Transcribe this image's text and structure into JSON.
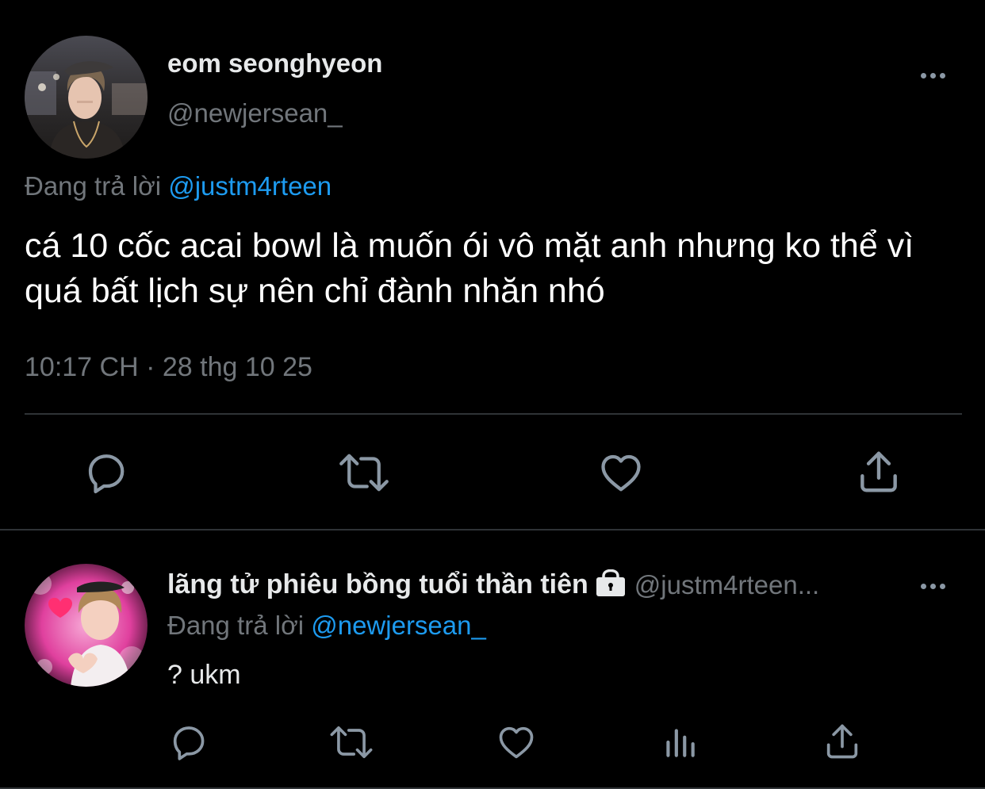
{
  "main_tweet": {
    "display_name": "eom seonghyeon",
    "handle": "@newjersean_",
    "reply_prefix": "Đang trả lời",
    "reply_mention": "@justm4rteen",
    "text": "cá 10 cốc acai bowl là muốn ói vô mặt anh nhưng ko thể vì quá bất lịch sự nên chỉ đành nhăn nhó",
    "timestamp": "10:17 CH · 28 thg 10 25",
    "actions": [
      "reply-icon",
      "retweet-icon",
      "like-icon",
      "share-icon"
    ]
  },
  "reply_tweet": {
    "display_name": "lãng tử phiêu bồng tuổi thần tiên",
    "handle": "@justm4rteen...",
    "reply_prefix": "Đang trả lời",
    "reply_mention": "@newjersean_",
    "text": "? ukm",
    "actions": [
      "reply-icon",
      "retweet-icon",
      "like-icon",
      "analytics-icon",
      "share-icon"
    ]
  },
  "colors": {
    "background": "#000000",
    "text_primary": "#e7e9ea",
    "text_secondary": "#71767b",
    "link": "#1d9bf0",
    "icon": "#8b98a5",
    "divider": "#2f3336"
  }
}
